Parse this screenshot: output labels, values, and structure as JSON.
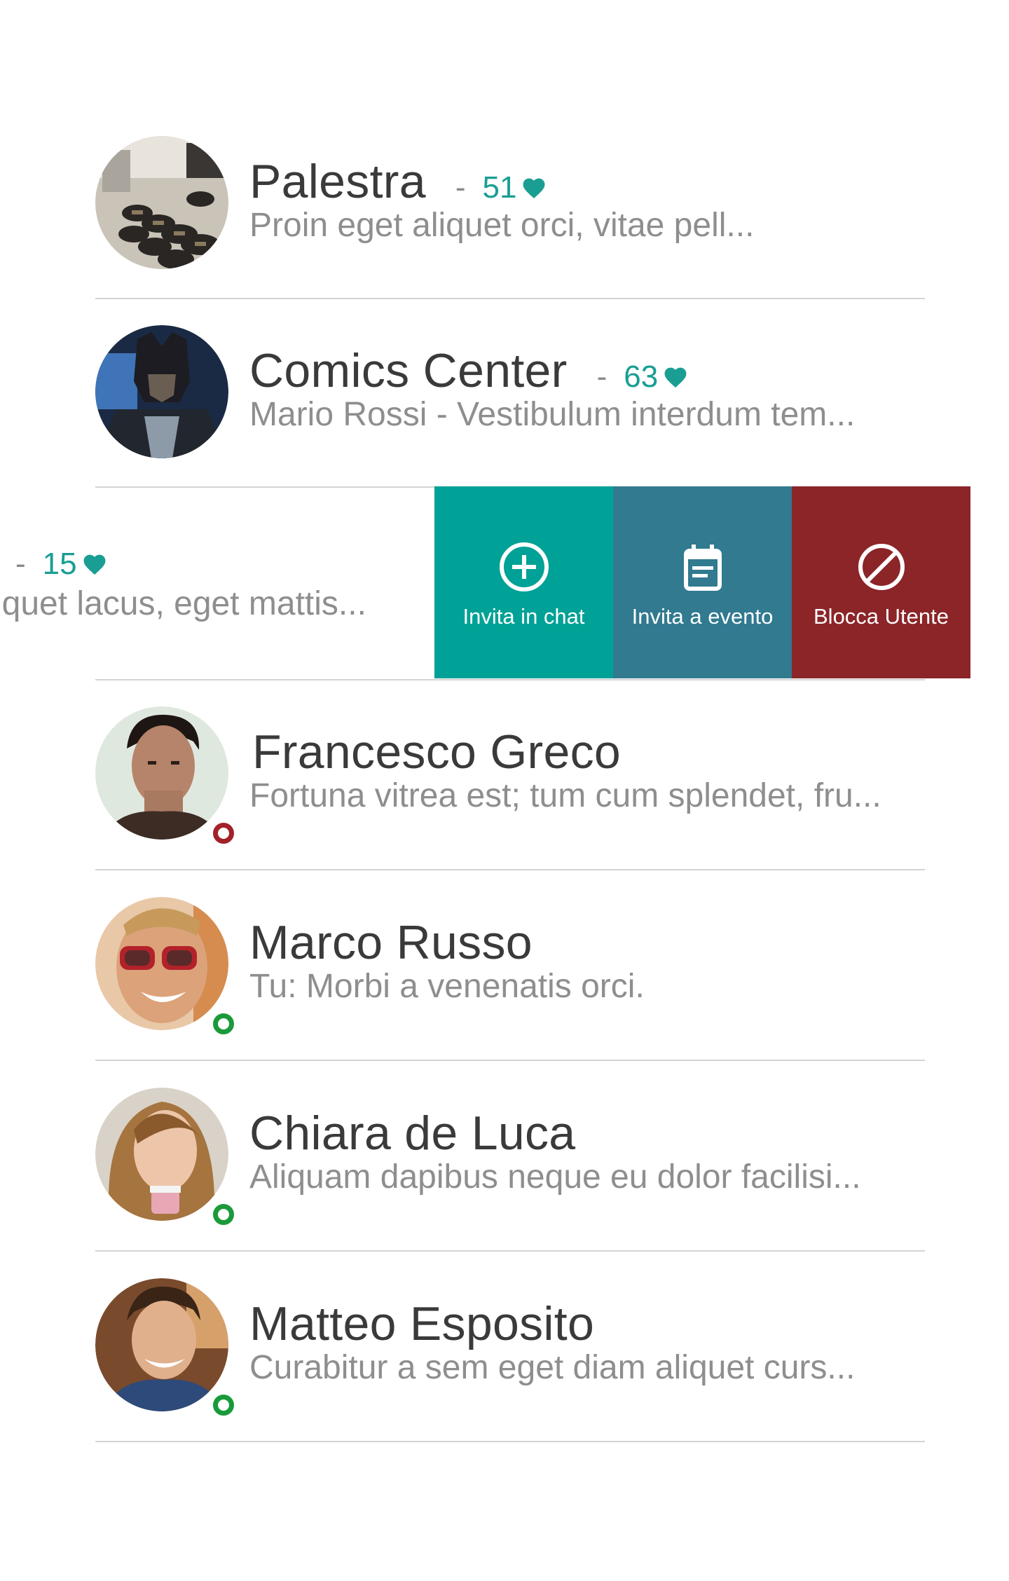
{
  "colors": {
    "teal": "#00a196",
    "slate_teal": "#317a90",
    "block_red": "#8b2528",
    "like_teal": "#1a9e94",
    "online": "#1a9a3a",
    "offline": "#a3222a"
  },
  "rows": [
    {
      "name": "Palestra",
      "likes": "51",
      "preview": "Proin eget aliquet orci, vitae pell...",
      "avatar": "gym-dumbbells-avatar"
    },
    {
      "name": "Comics Center",
      "likes": "63",
      "preview": "Mario Rossi - Vestibulum interdum tem...",
      "avatar": "superhero-avatar"
    },
    {
      "name": "",
      "likes": "15",
      "preview": "iquet lacus, eget mattis...",
      "swiped": true
    },
    {
      "name": "Francesco Greco",
      "preview": "Fortuna vitrea est; tum cum splendet, fru...",
      "status": "offline"
    },
    {
      "name": "Marco Russo",
      "preview": "Tu: Morbi a venenatis orci.",
      "status": "online"
    },
    {
      "name": "Chiara de Luca",
      "preview": "Aliquam dapibus neque eu dolor facilisi...",
      "status": "online"
    },
    {
      "name": "Matteo Esposito",
      "preview": "Curabitur a sem eget diam aliquet curs...",
      "status": "online"
    }
  ],
  "like_dash": "-",
  "actions": [
    {
      "label": "Invita in chat",
      "icon": "add-circle-icon",
      "color": "#00a196"
    },
    {
      "label": "Invita a evento",
      "icon": "calendar-icon",
      "color": "#317a90"
    },
    {
      "label": "Blocca Utente",
      "icon": "block-icon",
      "color": "#8b2528"
    }
  ]
}
